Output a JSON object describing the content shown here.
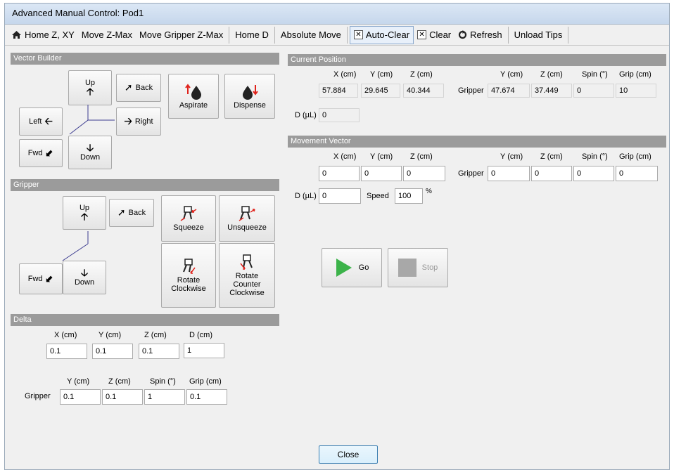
{
  "window": {
    "title": "Advanced Manual Control: Pod1"
  },
  "toolbar": {
    "home_zxy": "Home Z, XY",
    "move_zmax": "Move Z-Max",
    "move_gripper_zmax": "Move Gripper Z-Max",
    "home_d": "Home D",
    "absolute_move": "Absolute Move",
    "auto_clear": "Auto-Clear",
    "clear": "Clear",
    "refresh": "Refresh",
    "unload_tips": "Unload Tips"
  },
  "vector_builder": {
    "header": "Vector Builder",
    "up": "Up",
    "back": "Back",
    "left": "Left",
    "right": "Right",
    "fwd": "Fwd",
    "down": "Down",
    "aspirate": "Aspirate",
    "dispense": "Dispense"
  },
  "gripper": {
    "header": "Gripper",
    "up": "Up",
    "back": "Back",
    "fwd": "Fwd",
    "down": "Down",
    "squeeze": "Squeeze",
    "unsqueeze": "Unsqueeze",
    "rotate_cw": "Rotate Clockwise",
    "rotate_ccw": "Rotate Counter Clockwise"
  },
  "delta": {
    "header": "Delta",
    "x_label": "X (cm)",
    "y_label": "Y (cm)",
    "z_label": "Z (cm)",
    "d_label": "D (cm)",
    "x": "0.1",
    "y": "0.1",
    "z": "0.1",
    "d": "1",
    "gripper_label": "Gripper",
    "gy_label": "Y (cm)",
    "gz_label": "Z (cm)",
    "gspin_label": "Spin (°)",
    "ggrip_label": "Grip (cm)",
    "gy": "0.1",
    "gz": "0.1",
    "gspin": "1",
    "ggrip": "0.1"
  },
  "current_position": {
    "header": "Current Position",
    "x_label": "X (cm)",
    "y_label": "Y (cm)",
    "z_label": "Z (cm)",
    "x": "57.884",
    "y": "29.645",
    "z": "40.344",
    "gripper_label": "Gripper",
    "gy_label": "Y (cm)",
    "gz_label": "Z (cm)",
    "gspin_label": "Spin (°)",
    "ggrip_label": "Grip (cm)",
    "gy": "47.674",
    "gz": "37.449",
    "gspin": "0",
    "ggrip": "10",
    "d_label": "D (µL)",
    "d": "0"
  },
  "movement_vector": {
    "header": "Movement Vector",
    "x_label": "X (cm)",
    "y_label": "Y (cm)",
    "z_label": "Z (cm)",
    "x": "0",
    "y": "0",
    "z": "0",
    "gripper_label": "Gripper",
    "gy_label": "Y (cm)",
    "gz_label": "Z (cm)",
    "gspin_label": "Spin (°)",
    "ggrip_label": "Grip (cm)",
    "gy": "0",
    "gz": "0",
    "gspin": "0",
    "ggrip": "0",
    "d_label": "D (µL)",
    "d": "0",
    "speed_label": "Speed",
    "speed": "100",
    "speed_unit": "%"
  },
  "actions": {
    "go": "Go",
    "stop": "Stop",
    "close": "Close"
  },
  "colors": {
    "go_green": "#3cb34a",
    "stop_gray": "#a8a8a8",
    "section_gray": "#9b9b9b",
    "arrow_red": "#e0231c"
  }
}
